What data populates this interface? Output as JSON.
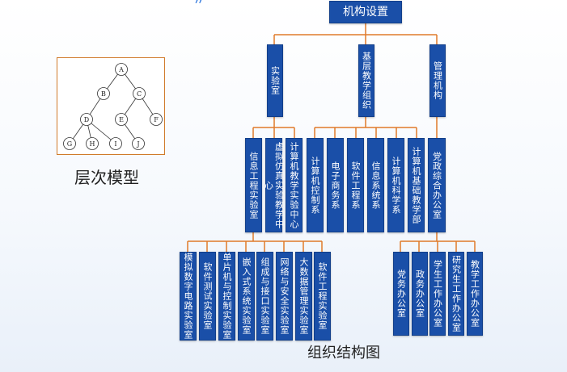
{
  "colors": {
    "node_fill": "#1a4fa8",
    "line": "#e07a2a",
    "tree_border": "#d07a2a"
  },
  "root": {
    "label": "机构设置"
  },
  "level1": [
    {
      "label": "实验室"
    },
    {
      "label": "基层教学组织"
    },
    {
      "label": "管理机构"
    }
  ],
  "labs": [
    {
      "label": "信息工程实验室"
    },
    {
      "label": "虚拟仿真实验教学中心"
    },
    {
      "label": "计算机教学实验中心"
    }
  ],
  "teaching": [
    {
      "label": "计算机控制系"
    },
    {
      "label": "电子商务系"
    },
    {
      "label": "软件工程系"
    },
    {
      "label": "信息系统系"
    },
    {
      "label": "计算机科学系"
    },
    {
      "label": "计算机基础教学部"
    }
  ],
  "admin": [
    {
      "label": "党政综合办公室"
    }
  ],
  "info_labs": [
    {
      "label": "模拟数字电路实验室"
    },
    {
      "label": "软件测试实验室"
    },
    {
      "label": "单片机与控制实验室"
    },
    {
      "label": "嵌入式系统实验室"
    },
    {
      "label": "组成与接口实验室"
    },
    {
      "label": "网络与安全实验室"
    },
    {
      "label": "大数据管理实验室"
    },
    {
      "label": "软件工程实验室"
    }
  ],
  "offices": [
    {
      "label": "党务办公室"
    },
    {
      "label": "政务办公室"
    },
    {
      "label": "学生工作办公室"
    },
    {
      "label": "研究生工作办公室"
    },
    {
      "label": "教学工作办公室"
    }
  ],
  "tree_model": {
    "caption": "层次模型",
    "nodes": [
      "A",
      "B",
      "C",
      "D",
      "E",
      "F",
      "G",
      "H",
      "I",
      "J"
    ]
  },
  "footer_caption": "组织结构图"
}
